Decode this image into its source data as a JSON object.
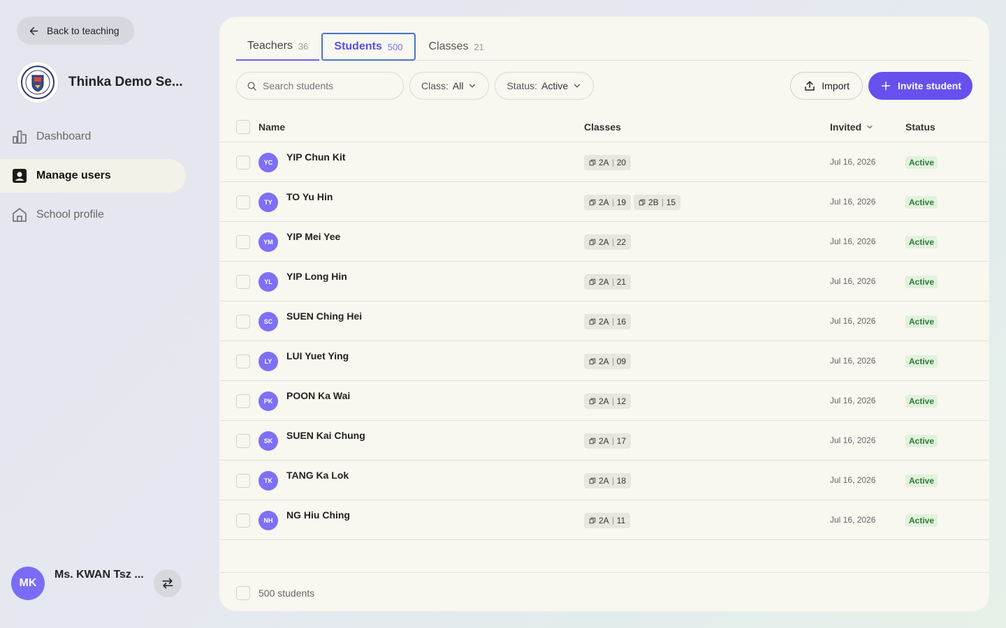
{
  "sidebar": {
    "back_label": "Back to teaching",
    "school_name": "Thinka Demo Se...",
    "nav": [
      {
        "label": "Dashboard",
        "icon": "bar-chart-icon",
        "active": false
      },
      {
        "label": "Manage users",
        "icon": "user-square-icon",
        "active": true
      },
      {
        "label": "School profile",
        "icon": "home-icon",
        "active": false
      }
    ],
    "user": {
      "initials": "MK",
      "name": "Ms. KWAN Tsz ..."
    }
  },
  "tabs": [
    {
      "label": "Teachers",
      "count": "36"
    },
    {
      "label": "Students",
      "count": "500"
    },
    {
      "label": "Classes",
      "count": "21"
    }
  ],
  "toolbar": {
    "search_placeholder": "Search students",
    "class_filter_label": "Class:",
    "class_filter_value": "All",
    "status_filter_label": "Status:",
    "status_filter_value": "Active",
    "import_label": "Import",
    "invite_label": "Invite student"
  },
  "table": {
    "headers": {
      "name": "Name",
      "classes": "Classes",
      "invited": "Invited",
      "status": "Status"
    },
    "rows": [
      {
        "initials": "YC",
        "name": "YIP Chun Kit",
        "classes": [
          {
            "cls": "2A",
            "no": "20"
          }
        ],
        "invited": "Jul 16, 2026",
        "status": "Active"
      },
      {
        "initials": "TY",
        "name": "TO Yu Hin",
        "classes": [
          {
            "cls": "2A",
            "no": "19"
          },
          {
            "cls": "2B",
            "no": "15"
          }
        ],
        "invited": "Jul 16, 2026",
        "status": "Active"
      },
      {
        "initials": "YM",
        "name": "YIP Mei Yee",
        "classes": [
          {
            "cls": "2A",
            "no": "22"
          }
        ],
        "invited": "Jul 16, 2026",
        "status": "Active"
      },
      {
        "initials": "YL",
        "name": "YIP Long Hin",
        "classes": [
          {
            "cls": "2A",
            "no": "21"
          }
        ],
        "invited": "Jul 16, 2026",
        "status": "Active"
      },
      {
        "initials": "SC",
        "name": "SUEN Ching Hei",
        "classes": [
          {
            "cls": "2A",
            "no": "16"
          }
        ],
        "invited": "Jul 16, 2026",
        "status": "Active"
      },
      {
        "initials": "LY",
        "name": "LUI Yuet Ying",
        "classes": [
          {
            "cls": "2A",
            "no": "09"
          }
        ],
        "invited": "Jul 16, 2026",
        "status": "Active"
      },
      {
        "initials": "PK",
        "name": "POON Ka Wai",
        "classes": [
          {
            "cls": "2A",
            "no": "12"
          }
        ],
        "invited": "Jul 16, 2026",
        "status": "Active"
      },
      {
        "initials": "SK",
        "name": "SUEN Kai Chung",
        "classes": [
          {
            "cls": "2A",
            "no": "17"
          }
        ],
        "invited": "Jul 16, 2026",
        "status": "Active"
      },
      {
        "initials": "TK",
        "name": "TANG Ka Lok",
        "classes": [
          {
            "cls": "2A",
            "no": "18"
          }
        ],
        "invited": "Jul 16, 2026",
        "status": "Active"
      },
      {
        "initials": "NH",
        "name": "NG Hiu Ching",
        "classes": [
          {
            "cls": "2A",
            "no": "11"
          }
        ],
        "invited": "Jul 16, 2026",
        "status": "Active"
      }
    ]
  },
  "footer": {
    "count_label": "500 students"
  },
  "colors": {
    "accent": "#6650ee",
    "status_active": "#2c7a3a",
    "avatar": "#7e6ff5"
  }
}
